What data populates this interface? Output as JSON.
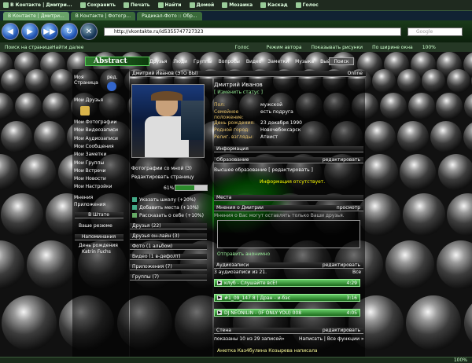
{
  "browser": {
    "menu": [
      "В Контакте | Дмитри...",
      "Сохранить",
      "Печать",
      "Найти",
      "Домой",
      "Мозаика",
      "Каскад",
      "Голос"
    ],
    "tabs": [
      "В Контакте | Дмитри...",
      "В Контакте | Фотогр...",
      "Радикал-Фото :: Обр..."
    ],
    "address": "http://vkontakte.ru/id5355747727323",
    "search_placeholder": "Google",
    "links": [
      "Поиск на странице",
      "Найти далее",
      "Голос",
      "Режим автора",
      "Показывать рисунки",
      "По ширине окна"
    ],
    "zoom": "100%",
    "status_zoom": "100%"
  },
  "site": {
    "logo": "Abstract",
    "topnav": [
      "Друзья",
      "Люди",
      "Группы",
      "Вопросы",
      "Видео",
      "Заметки",
      "Музыка",
      "Выйти"
    ],
    "search_button": "Поиск",
    "header_name": "Дмитрий Иванов (ЭТО ВЫ)",
    "header_online": "Online"
  },
  "sidebar": {
    "top": [
      "Моя Страница",
      "ред.",
      "Мои Друзья"
    ],
    "items": [
      "Мои Фотографии",
      "Мои Видеозаписи",
      "Мои Аудиозаписи",
      "Мои Сообщения",
      "Мои Заметки",
      "Мои Группы",
      "Мои Встречи",
      "Мои Новости",
      "Мои Настройки"
    ],
    "extra": [
      "Мнения",
      "Приложения"
    ],
    "shtat": "В Штате",
    "shtat_sub": "Ваше резюме",
    "napominaniya": "Напоминания",
    "birthday_label": "День рождения",
    "birthday_name": "Katrin Fuchs"
  },
  "profile": {
    "name": "Дмитрий Иванов",
    "status_link": "[ Изменить статус ]",
    "fields": [
      {
        "label": "Пол:",
        "value": "мужской"
      },
      {
        "label": "Семейное положение:",
        "value": "есть подруга"
      },
      {
        "label": "День рождения:",
        "value": "23 декабря 1990"
      },
      {
        "label": "Родной город:",
        "value": "Новочебоксарск"
      },
      {
        "label": "Религ. взгляды:",
        "value": "Атеист"
      }
    ],
    "info_bar": "Информация",
    "education_bar": "Образование",
    "edit_label": "редактировать",
    "higher_ed": "Высшее образование [ редактировать ]",
    "info_absent": "Информация отсутствует.",
    "places_bar": "Места",
    "opinions_bar": "Мнения о Дмитрии",
    "view_label": "просмотр",
    "opinions_hint": "Мнения о Вас могут оставлять только Ваши друзья.",
    "send_anon": "Отправить анонимно"
  },
  "photo_block": {
    "photos_with_me": "Фотографии со мной (3)",
    "edit_page": "Редактировать страницу",
    "percent": "61%",
    "percent_value": 61,
    "tips": [
      "Указать школу (+20%)",
      "Добавить места (+10%)",
      "Рассказать о себе (+10%)"
    ],
    "sections": [
      "Друзья (22)",
      "Друзья он-лайн (3)",
      "Фото (1 альбом)",
      "Видео (1 в-дефолт)",
      "Приложения (7)",
      "Группы (7)"
    ]
  },
  "audio": {
    "bar": "Аудиозаписи",
    "edit": "редактировать",
    "count_text": "3 аудиозаписи из 21.",
    "all": "Все",
    "tracks": [
      {
        "title": "клуб - Слушайте всЕ!",
        "time": "4:29"
      },
      {
        "title": "#1_09_147 8 | Дран - и-бэс",
        "time": "3:16"
      },
      {
        "title": "DJ NEONILIN - (IF ONLY YOU) 008",
        "time": "4:05"
      }
    ]
  },
  "wall": {
    "bar": "Стена",
    "edit": "редактировать",
    "count_text": "показаны 10 из 29 записей»",
    "links": "Написать | Все функции »",
    "entry": "Анютка Каз4булина Козырева написала"
  }
}
